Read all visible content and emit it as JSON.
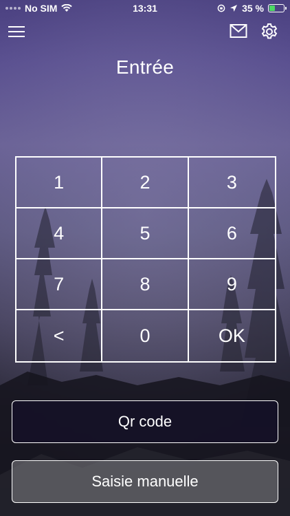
{
  "status_bar": {
    "carrier": "No SIM",
    "time": "13:31",
    "battery": "35 %",
    "battery_level": 0.35,
    "icons": [
      "signal-dots-icon",
      "wifi-icon",
      "orientation-lock-icon",
      "location-arrow-icon",
      "battery-charging-icon"
    ]
  },
  "header": {
    "menu_icon": "hamburger-menu-icon",
    "mail_icon": "mail-icon",
    "settings_icon": "gear-icon"
  },
  "title": "Entrée",
  "keypad": {
    "keys": [
      "1",
      "2",
      "3",
      "4",
      "5",
      "6",
      "7",
      "8",
      "9",
      "<",
      "0",
      "OK"
    ]
  },
  "buttons": {
    "qr_code": "Qr code",
    "manual_entry": "Saisie manuelle"
  },
  "colors": {
    "background_top": "#4a4080",
    "background_bottom": "#1c1b24",
    "text": "#ffffff",
    "battery_fill": "#4cd964"
  }
}
